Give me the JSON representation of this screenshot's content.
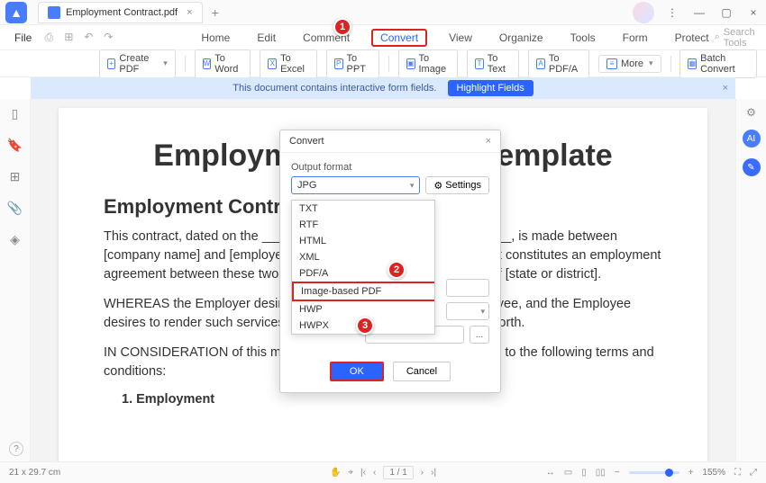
{
  "titlebar": {
    "tab_name": "Employment Contract.pdf"
  },
  "menu": {
    "file": "File"
  },
  "main_tabs": [
    "Home",
    "Edit",
    "Comment",
    "Convert",
    "View",
    "Organize",
    "Tools",
    "Form",
    "Protect"
  ],
  "active_tab_index": 3,
  "search_placeholder": "Search Tools",
  "toolbar": {
    "create": "Create PDF",
    "word": "To Word",
    "excel": "To Excel",
    "ppt": "To PPT",
    "image": "To Image",
    "text": "To Text",
    "pdfa": "To PDF/A",
    "more": "More",
    "batch": "Batch Convert"
  },
  "notice": {
    "msg": "This document contains interactive form fields.",
    "btn": "Highlight Fields"
  },
  "doc": {
    "title": "Employment Contract Template",
    "h2": "Employment Contract",
    "p1": "This contract, dated on the ____ day of _________ in the year 20____, is made between [company name] and [employee name] of [city, state]. This document constitutes an employment agreement between these two parties and is governed by the laws of [state or district].",
    "p2": "WHEREAS the Employer desires to retain the services of the Employee, and the Employee desires to render such services, these terms and conditions are set forth.",
    "p3": "IN CONSIDERATION of this mutual understanding, the parties agree to the following terms and conditions:",
    "li1": "1.   Employment"
  },
  "dialog": {
    "title": "Convert",
    "label": "Output format",
    "selected": "JPG",
    "settings": "Settings",
    "options": [
      "TXT",
      "RTF",
      "HTML",
      "XML",
      "PDF/A",
      "Image-based PDF",
      "HWP",
      "HWPX"
    ],
    "marked_index": 5,
    "ok": "OK",
    "cancel": "Cancel",
    "dots": "..."
  },
  "badges": {
    "b1": "1",
    "b2": "2",
    "b3": "3"
  },
  "status": {
    "page_size": "21 x 29.7 cm",
    "page": "1 / 1",
    "zoom": "155%"
  }
}
